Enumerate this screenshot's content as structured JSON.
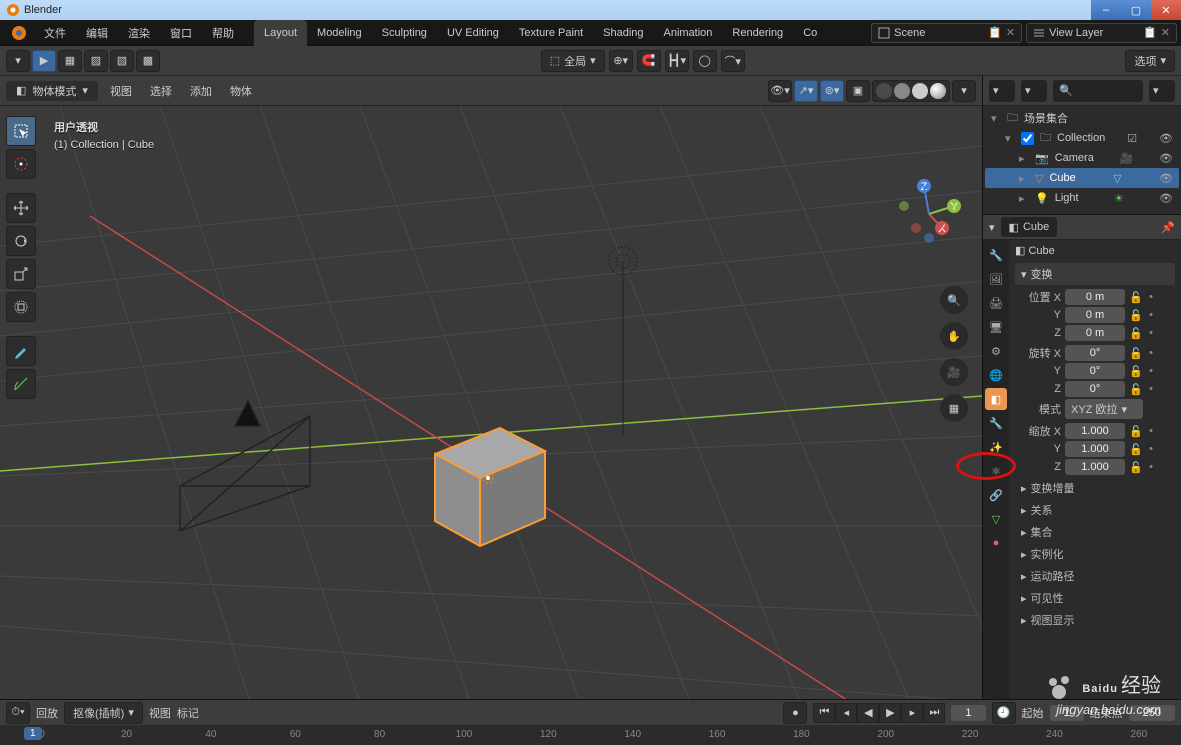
{
  "title": "Blender",
  "menu": [
    "文件",
    "编辑",
    "渲染",
    "窗口",
    "帮助"
  ],
  "workspaces": [
    "Layout",
    "Modeling",
    "Sculpting",
    "UV Editing",
    "Texture Paint",
    "Shading",
    "Animation",
    "Rendering",
    "Co"
  ],
  "active_workspace": "Layout",
  "scene": "Scene",
  "view_layer": "View Layer",
  "pivot_label": "全局",
  "options_label": "选项",
  "object_mode": "物体模式",
  "viewmenu": [
    "视图",
    "选择",
    "添加",
    "物体"
  ],
  "vp_label_title": "用户透视",
  "vp_label_sub": "(1) Collection | Cube",
  "outliner_title": "场景集合",
  "outliner": [
    {
      "name": "Collection",
      "icon": "collection",
      "children": [
        {
          "name": "Camera",
          "icon": "camera",
          "color": "#d8863a"
        },
        {
          "name": "Cube",
          "icon": "mesh",
          "color": "#d8863a",
          "selected": true
        },
        {
          "name": "Light",
          "icon": "light",
          "color": "#d8863a"
        }
      ]
    }
  ],
  "prop_breadcrumb": "Cube",
  "prop_name_field": "Cube",
  "panel_transform": "变换",
  "loc_label": "位置",
  "rot_label": "旋转",
  "scale_label": "缩放",
  "mode_label": "模式",
  "mode_value": "XYZ 欧拉",
  "loc": {
    "X": "0 m",
    "Y": "0 m",
    "Z": "0 m"
  },
  "rot": {
    "X": "0°",
    "Y": "0°",
    "Z": "0°"
  },
  "scale": {
    "X": "1.000",
    "Y": "1.000",
    "Z": "1.000"
  },
  "panels_collapsed": [
    "变换增量",
    "关系",
    "集合",
    "实例化",
    "运动路径",
    "可见性",
    "视图显示"
  ],
  "tl_playback": "回放",
  "tl_keying": "抠像(插帧)",
  "tl_view": "视图",
  "tl_marker": "标记",
  "tl_current": "1",
  "tl_start_lbl": "起始",
  "tl_start": "1",
  "tl_end_lbl": "结束点",
  "tl_end": "250",
  "ruler": [
    "0",
    "20",
    "40",
    "60",
    "80",
    "100",
    "120",
    "140",
    "160",
    "180",
    "200",
    "220",
    "240",
    "260"
  ],
  "watermark_big": "Bai",
  "watermark_du": "du",
  "watermark_cn": "经验",
  "watermark_sub": "jingyan.baidu.com"
}
